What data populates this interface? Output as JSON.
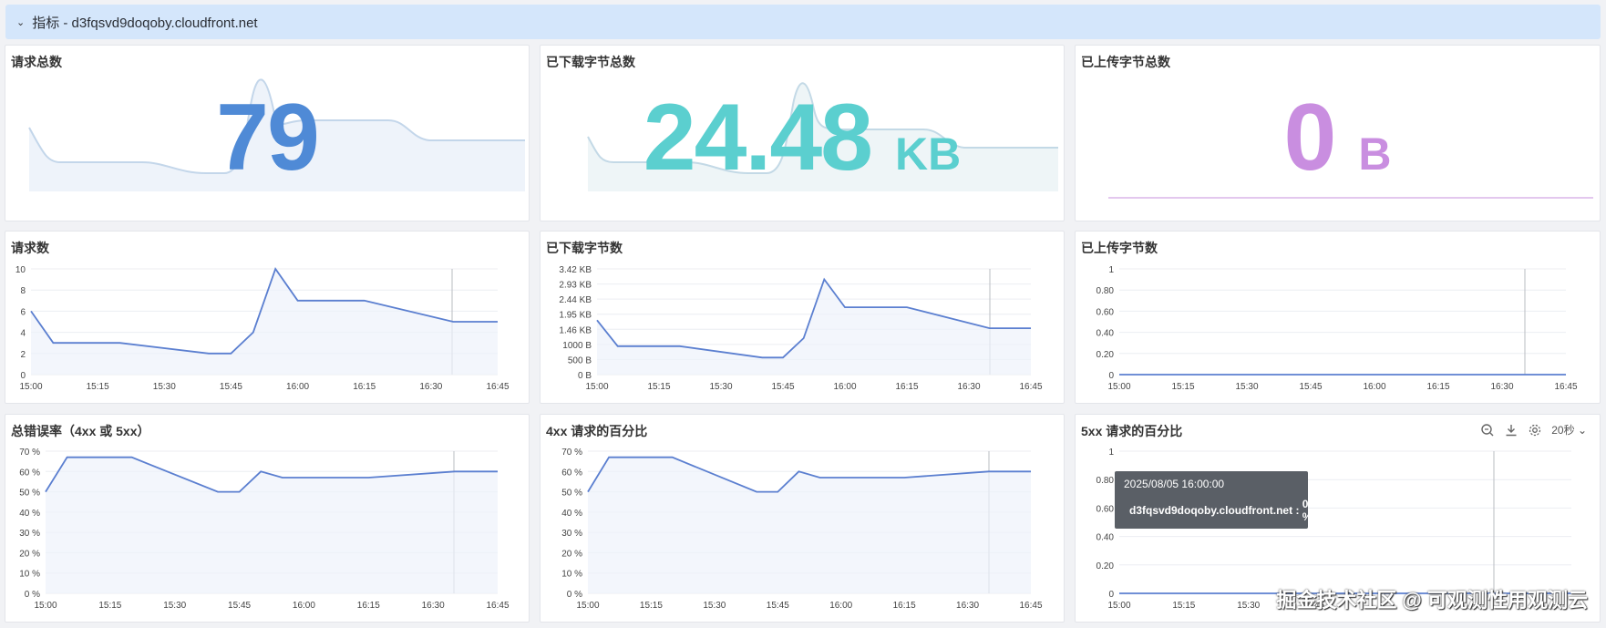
{
  "group": {
    "title": "指标 - d3fqsvd9doqoby.cloudfront.net"
  },
  "stats": [
    {
      "title": "请求总数",
      "value": "79",
      "unit": "",
      "color": "#4f8ad6"
    },
    {
      "title": "已下载字节总数",
      "value": "24.48",
      "unit": "KB",
      "color": "#5bcfcf"
    },
    {
      "title": "已上传字节总数",
      "value": "0",
      "unit": "B",
      "color": "#c98ee0"
    }
  ],
  "toolbar": {
    "refresh_label": "20秒"
  },
  "tooltip": {
    "time": "2025/08/05 16:00:00",
    "series": "d3fqsvd9doqoby.cloudfront.net",
    "value": "0 %"
  },
  "watermark": "掘金技术社区 @ 可观测性用观测云",
  "colors": {
    "line": "#5b7fd0",
    "header": "#d4e6fb"
  },
  "chart_data": [
    {
      "type": "line",
      "title": "请求数",
      "x": [
        "15:00",
        "15:05",
        "15:20",
        "15:40",
        "15:45",
        "15:50",
        "15:55",
        "16:00",
        "16:15",
        "16:35",
        "16:45"
      ],
      "values": [
        6,
        3,
        3,
        2,
        2,
        4,
        10,
        7,
        7,
        5,
        5
      ],
      "yticks": [
        "10",
        "8",
        "6",
        "4",
        "2",
        "0"
      ],
      "ylim": [
        0,
        10
      ],
      "xticks": [
        "15:00",
        "15:15",
        "15:30",
        "15:45",
        "16:00",
        "16:15",
        "16:30",
        "16:45"
      ]
    },
    {
      "type": "line",
      "title": "已下载字节数",
      "x": [
        "15:00",
        "15:05",
        "15:20",
        "15:40",
        "15:45",
        "15:50",
        "15:55",
        "16:00",
        "16:15",
        "16:35",
        "16:45"
      ],
      "values": [
        1.76,
        0.92,
        0.92,
        0.55,
        0.55,
        1.18,
        3.08,
        2.18,
        2.18,
        1.5,
        1.5
      ],
      "yticks": [
        "3.42 KB",
        "2.93 KB",
        "2.44 KB",
        "1.95 KB",
        "1.46 KB",
        "1000 B",
        "500 B",
        "0 B"
      ],
      "ylim": [
        0,
        3.42
      ],
      "xticks": [
        "15:00",
        "15:15",
        "15:30",
        "15:45",
        "16:00",
        "16:15",
        "16:30",
        "16:45"
      ]
    },
    {
      "type": "line",
      "title": "已上传字节数",
      "x": [
        "15:00",
        "16:45"
      ],
      "values": [
        0,
        0
      ],
      "yticks": [
        "1",
        "0.80",
        "0.60",
        "0.40",
        "0.20",
        "0"
      ],
      "ylim": [
        0,
        1
      ],
      "xticks": [
        "15:00",
        "15:15",
        "15:30",
        "15:45",
        "16:00",
        "16:15",
        "16:30",
        "16:45"
      ]
    },
    {
      "type": "line",
      "title": "总错误率（4xx 或 5xx）",
      "x": [
        "15:00",
        "15:05",
        "15:20",
        "15:40",
        "15:45",
        "15:50",
        "15:55",
        "16:00",
        "16:15",
        "16:35",
        "16:45"
      ],
      "values": [
        50,
        67,
        67,
        50,
        50,
        60,
        57,
        57,
        57,
        60,
        60
      ],
      "yticks": [
        "70 %",
        "60 %",
        "50 %",
        "40 %",
        "30 %",
        "20 %",
        "10 %",
        "0 %"
      ],
      "ylim": [
        0,
        70
      ],
      "xticks": [
        "15:00",
        "15:15",
        "15:30",
        "15:45",
        "16:00",
        "16:15",
        "16:30",
        "16:45"
      ]
    },
    {
      "type": "line",
      "title": "4xx 请求的百分比",
      "x": [
        "15:00",
        "15:05",
        "15:20",
        "15:40",
        "15:45",
        "15:50",
        "15:55",
        "16:00",
        "16:15",
        "16:35",
        "16:45"
      ],
      "values": [
        50,
        67,
        67,
        50,
        50,
        60,
        57,
        57,
        57,
        60,
        60
      ],
      "yticks": [
        "70 %",
        "60 %",
        "50 %",
        "40 %",
        "30 %",
        "20 %",
        "10 %",
        "0 %"
      ],
      "ylim": [
        0,
        70
      ],
      "xticks": [
        "15:00",
        "15:15",
        "15:30",
        "15:45",
        "16:00",
        "16:15",
        "16:30",
        "16:45"
      ]
    },
    {
      "type": "line",
      "title": "5xx 请求的百分比",
      "x": [
        "15:00",
        "16:45"
      ],
      "values": [
        0,
        0
      ],
      "yticks": [
        "1",
        "0.80",
        "0.60",
        "0.40",
        "0.20",
        "0"
      ],
      "ylim": [
        0,
        1
      ],
      "xticks": [
        "15:00",
        "15:15",
        "15:30",
        "15:45"
      ]
    }
  ]
}
